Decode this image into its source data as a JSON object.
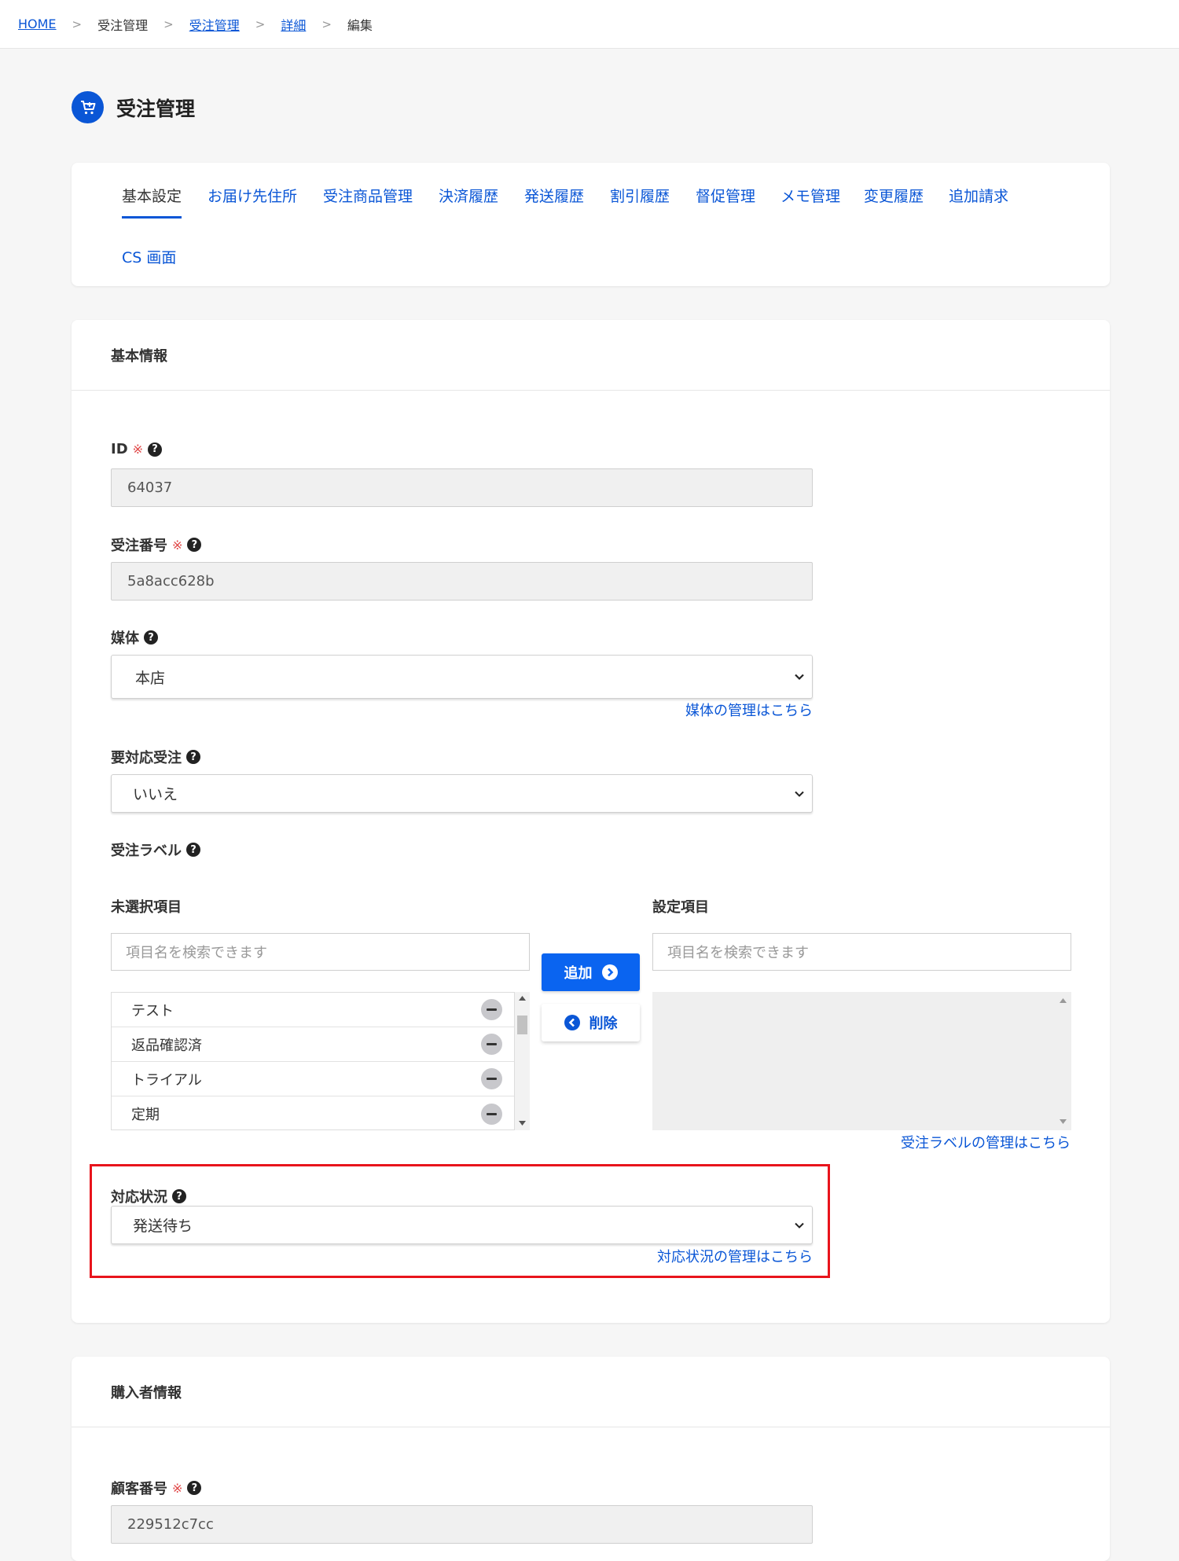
{
  "breadcrumb": {
    "home": "HOME",
    "sep": ">",
    "order_mgmt_plain": "受注管理",
    "order_mgmt_link": "受注管理",
    "detail": "詳細",
    "edit": "編集"
  },
  "page": {
    "title": "受注管理"
  },
  "tabs": [
    {
      "label": "基本設定",
      "active": true
    },
    {
      "label": "お届け先住所"
    },
    {
      "label": "受注商品管理"
    },
    {
      "label": "決済履歴"
    },
    {
      "label": "発送履歴"
    },
    {
      "label": "割引履歴"
    },
    {
      "label": "督促管理"
    },
    {
      "label": "メモ管理"
    },
    {
      "label": "変更履歴"
    },
    {
      "label": "追加請求"
    },
    {
      "label": "CS 画面"
    }
  ],
  "basic_info": {
    "header": "基本情報",
    "required_mark": "※",
    "help_mark": "?",
    "id": {
      "label": "ID",
      "value": "64037"
    },
    "order_number": {
      "label": "受注番号",
      "value": "5a8acc628b"
    },
    "media": {
      "label": "媒体",
      "value": "本店",
      "manage_link": "媒体の管理はこちら"
    },
    "needs_attention": {
      "label": "要対応受注",
      "value": "いいえ"
    },
    "order_label": {
      "label": "受注ラベル",
      "unselected_title": "未選択項目",
      "selected_title": "設定項目",
      "search_placeholder": "項目名を検索できます",
      "items": [
        "テスト",
        "返品確認済",
        "トライアル",
        "定期"
      ],
      "add_button": "追加",
      "delete_button": "削除",
      "manage_link": "受注ラベルの管理はこちら"
    },
    "status": {
      "label": "対応状況",
      "value": "発送待ち",
      "manage_link": "対応状況の管理はこちら"
    }
  },
  "buyer_info": {
    "header": "購入者情報",
    "customer_number": {
      "label": "顧客番号",
      "value": "229512c7cc"
    }
  },
  "colors": {
    "accent": "#0a56d6",
    "button": "#0a64f0",
    "required": "#e04646",
    "highlight": "#e8141c"
  }
}
